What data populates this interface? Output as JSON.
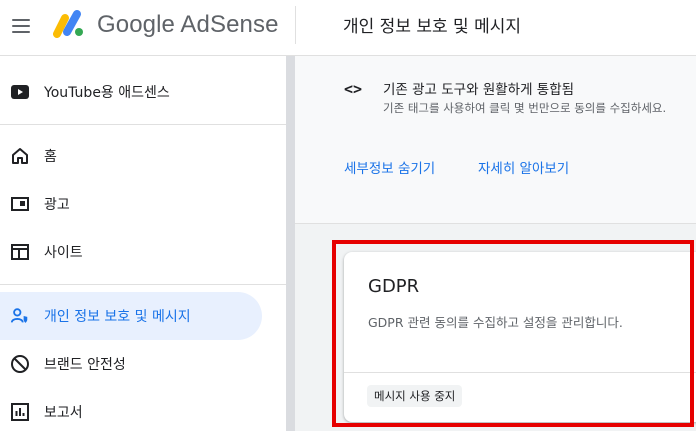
{
  "header": {
    "brand": "Google AdSense",
    "page_title": "개인 정보 보호 및 메시지"
  },
  "sidebar": {
    "items": [
      {
        "label": "YouTube용 애드센스",
        "icon": "youtube-icon"
      },
      {
        "label": "홈",
        "icon": "home-icon"
      },
      {
        "label": "광고",
        "icon": "ads-icon"
      },
      {
        "label": "사이트",
        "icon": "sites-icon"
      },
      {
        "label": "개인 정보 보호 및 메시지",
        "icon": "privacy-person-icon",
        "active": true
      },
      {
        "label": "브랜드 안전성",
        "icon": "block-icon"
      },
      {
        "label": "보고서",
        "icon": "reports-icon"
      }
    ]
  },
  "main": {
    "integration": {
      "title": "기존 광고 도구와 원활하게 통합됨",
      "description": "기존 태그를 사용하여 클릭 몇 번만으로 동의를 수집하세요."
    },
    "links": {
      "hide_details": "세부정보 숨기기",
      "learn_more": "자세히 알아보기"
    },
    "card": {
      "title": "GDPR",
      "description": "GDPR 관련 동의를 수집하고 설정을 관리합니다.",
      "status_chip": "메시지 사용 중지"
    }
  },
  "colors": {
    "accent": "#1a73e8",
    "active_bg": "#e8f0fe",
    "highlight": "#e60000"
  }
}
